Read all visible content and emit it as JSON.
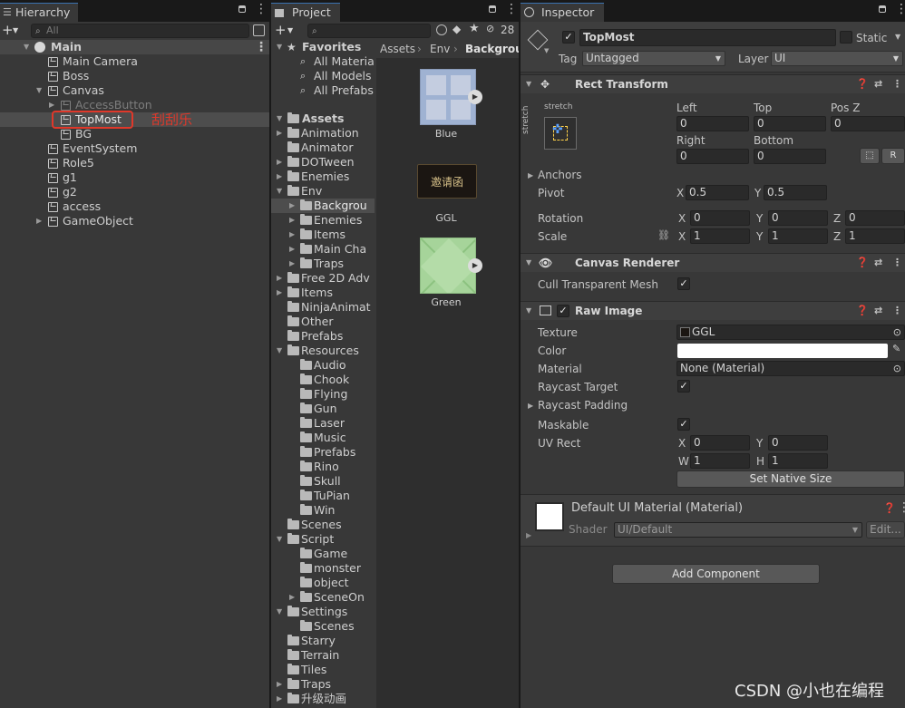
{
  "colors": {
    "accent": "#3a72b0",
    "highlight": "#e0382a",
    "bg": "#383838"
  },
  "hierarchy": {
    "tab": "Hierarchy",
    "search_placeholder": "All",
    "items": [
      {
        "label": "Main"
      },
      {
        "label": "Main Camera"
      },
      {
        "label": "Boss"
      },
      {
        "label": "Canvas"
      },
      {
        "label": "AccessButton"
      },
      {
        "label": "TopMost"
      },
      {
        "label": "BG"
      },
      {
        "label": "EventSystem"
      },
      {
        "label": "Role5"
      },
      {
        "label": "g1"
      },
      {
        "label": "g2"
      },
      {
        "label": "access"
      },
      {
        "label": "GameObject"
      }
    ],
    "annotation": "刮刮乐"
  },
  "project": {
    "tab": "Project",
    "hidden_count": "28",
    "breadcrumb": [
      "Assets",
      "Env",
      "Backgroun"
    ],
    "favorites_label": "Favorites",
    "favorites": [
      "All Materials",
      "All Models",
      "All Prefabs"
    ],
    "assets_label": "Assets",
    "tree": [
      "Animation",
      "Animator",
      "DOTween",
      "Enemies",
      "Env",
      "Backgrou",
      "Enemies",
      "Items",
      "Main Cha",
      "Traps",
      "Free 2D Adv",
      "Items",
      "NinjaAnimat",
      "Other",
      "Prefabs",
      "Resources",
      "Audio",
      "Chook",
      "Flying",
      "Gun",
      "Laser",
      "Music",
      "Prefabs",
      "Rino",
      "Skull",
      "TuPian",
      "Win",
      "Scenes",
      "Script",
      "Game",
      "monster",
      "object",
      "SceneOn",
      "Settings",
      "Scenes",
      "Starry",
      "Terrain",
      "Tiles",
      "Traps",
      "升级动画"
    ],
    "assets": [
      {
        "name": "Blue"
      },
      {
        "name": "GGL",
        "thumb_text": "邀请函"
      },
      {
        "name": "Green"
      }
    ]
  },
  "inspector": {
    "tab": "Inspector",
    "object_name": "TopMost",
    "static_label": "Static",
    "tag_label": "Tag",
    "tag_value": "Untagged",
    "layer_label": "Layer",
    "layer_value": "UI",
    "rect_transform": {
      "title": "Rect Transform",
      "anchor_preset_top": "stretch",
      "anchor_preset_side": "stretch",
      "left_label": "Left",
      "left": "0",
      "top_label": "Top",
      "top": "0",
      "posz_label": "Pos Z",
      "posz": "0",
      "right_label": "Right",
      "right": "0",
      "bottom_label": "Bottom",
      "bottom": "0",
      "anchors_label": "Anchors",
      "pivot_label": "Pivot",
      "pivot_x": "0.5",
      "pivot_y": "0.5",
      "rotation_label": "Rotation",
      "rot_x": "0",
      "rot_y": "0",
      "rot_z": "0",
      "scale_label": "Scale",
      "scale_x": "1",
      "scale_y": "1",
      "scale_z": "1",
      "r_button": "R"
    },
    "canvas_renderer": {
      "title": "Canvas Renderer",
      "cull_label": "Cull Transparent Mesh"
    },
    "raw_image": {
      "title": "Raw Image",
      "texture_label": "Texture",
      "texture_value": "GGL",
      "color_label": "Color",
      "material_label": "Material",
      "material_value": "None (Material)",
      "raycast_target_label": "Raycast Target",
      "raycast_padding_label": "Raycast Padding",
      "maskable_label": "Maskable",
      "uvrect_label": "UV Rect",
      "uv_x": "0",
      "uv_y": "0",
      "uv_w": "1",
      "uv_h": "1",
      "set_native_size": "Set Native Size"
    },
    "material": {
      "title": "Default UI Material (Material)",
      "shader_label": "Shader",
      "shader_value": "UI/Default",
      "edit_button": "Edit..."
    },
    "add_component": "Add Component",
    "axis": {
      "x": "X",
      "y": "Y",
      "z": "Z",
      "w": "W",
      "h": "H"
    }
  },
  "watermark": "CSDN @小也在编程"
}
